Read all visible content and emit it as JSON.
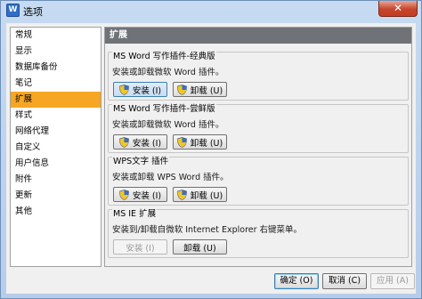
{
  "window": {
    "title": "选项",
    "close_glyph": "✕",
    "app_icon_glyph": "W"
  },
  "sidebar": {
    "items": [
      {
        "label": "常规"
      },
      {
        "label": "显示"
      },
      {
        "label": "数据库备份"
      },
      {
        "label": "笔记"
      },
      {
        "label": "扩展",
        "selected": true
      },
      {
        "label": "样式"
      },
      {
        "label": "网络代理"
      },
      {
        "label": "自定义"
      },
      {
        "label": "用户信息"
      },
      {
        "label": "附件"
      },
      {
        "label": "更新"
      },
      {
        "label": "其他"
      }
    ]
  },
  "panel": {
    "header": "扩展",
    "groups": [
      {
        "title": "MS Word 写作插件-经典版",
        "desc": "安装或卸载微软 Word 插件。",
        "install": "安装 (I)",
        "uninstall": "卸载 (U)",
        "install_enabled": true
      },
      {
        "title": "MS Word 写作插件-尝鲜版",
        "desc": "安装或卸载微软 Word 插件。",
        "install": "安装 (I)",
        "uninstall": "卸载 (U)",
        "install_enabled": true
      },
      {
        "title": "WPS文字 插件",
        "desc": "安装或卸载 WPS Word 插件。",
        "install": "安装 (I)",
        "uninstall": "卸载 (U)",
        "install_enabled": true
      },
      {
        "title": "MS IE 扩展",
        "desc": "安装到/卸载自微软 Internet Explorer 右键菜单。",
        "install": "安装 (I)",
        "uninstall": "卸载 (U)",
        "install_enabled": false
      }
    ]
  },
  "footer": {
    "ok": "确定 (O)",
    "cancel": "取消 (C)",
    "apply": "应用 (A)"
  },
  "icons": {
    "shield": "uac-shield-icon"
  },
  "colors": {
    "selected_item": "#f6a623",
    "panel_header": "#6f7378",
    "close": "#c43c22"
  }
}
